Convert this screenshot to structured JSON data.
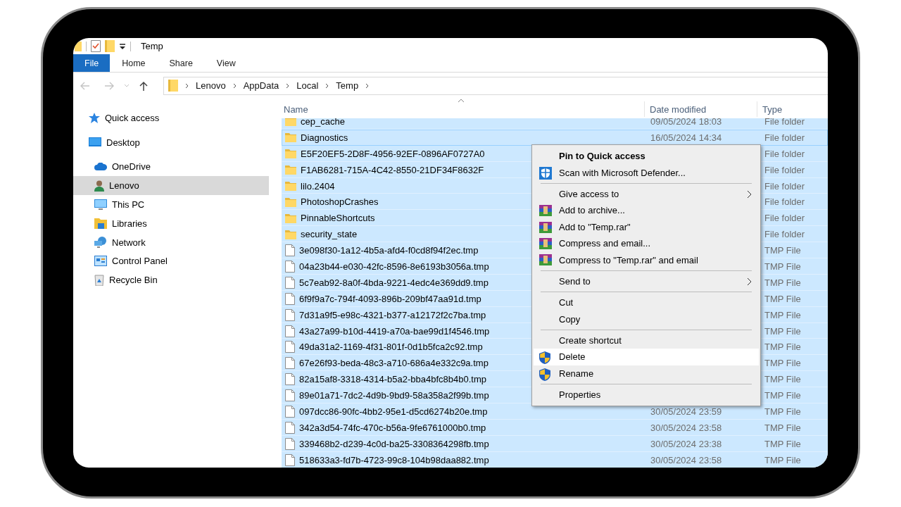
{
  "window": {
    "title": "Temp"
  },
  "ribbon_tabs": [
    {
      "label": "File",
      "selected": true
    },
    {
      "label": "Home",
      "selected": false
    },
    {
      "label": "Share",
      "selected": false
    },
    {
      "label": "View",
      "selected": false
    }
  ],
  "address_bar": {
    "path": [
      "Lenovo",
      "AppData",
      "Local",
      "Temp"
    ]
  },
  "sidebar": {
    "items": [
      {
        "label": "Quick access",
        "kind": "quick-access",
        "selected": false
      },
      {
        "label": "Desktop",
        "kind": "desktop",
        "selected": false,
        "children": [
          {
            "label": "OneDrive",
            "kind": "cloud",
            "selected": false
          },
          {
            "label": "Lenovo",
            "kind": "user",
            "selected": true
          },
          {
            "label": "This PC",
            "kind": "pc",
            "selected": false
          },
          {
            "label": "Libraries",
            "kind": "libraries",
            "selected": false
          },
          {
            "label": "Network",
            "kind": "network",
            "selected": false
          },
          {
            "label": "Control Panel",
            "kind": "control-panel",
            "selected": false
          },
          {
            "label": "Recycle Bin",
            "kind": "recycle-bin",
            "selected": false
          }
        ]
      }
    ]
  },
  "table": {
    "columns": [
      "Name",
      "Date modified",
      "Type"
    ],
    "rows": [
      {
        "name": "cep_cache",
        "kind": "folder",
        "date": "09/05/2024 18:03",
        "type": "File folder",
        "selected": true,
        "focused": false
      },
      {
        "name": "Diagnostics",
        "kind": "folder",
        "date": "16/05/2024 14:34",
        "type": "File folder",
        "selected": true,
        "focused": true
      },
      {
        "name": "E5F20EF5-2D8F-4956-92EF-0896AF0727A0",
        "kind": "folder",
        "type": "File folder",
        "selected": true,
        "focused": false
      },
      {
        "name": "F1AB6281-715A-4C42-8550-21DF34F8632F",
        "kind": "folder",
        "type": "File folder",
        "selected": true,
        "focused": false
      },
      {
        "name": "lilo.2404",
        "kind": "folder",
        "type": "File folder",
        "selected": true,
        "focused": false
      },
      {
        "name": "PhotoshopCrashes",
        "kind": "folder",
        "type": "File folder",
        "selected": true,
        "focused": false
      },
      {
        "name": "PinnableShortcuts",
        "kind": "folder",
        "type": "File folder",
        "selected": true,
        "focused": false
      },
      {
        "name": "security_state",
        "kind": "folder",
        "type": "File folder",
        "selected": true,
        "focused": false
      },
      {
        "name": "3e098f30-1a12-4b5a-afd4-f0cd8f94f2ec.tmp",
        "kind": "file",
        "type": "TMP File",
        "selected": true,
        "focused": false
      },
      {
        "name": "04a23b44-e030-42fc-8596-8e6193b3056a.tmp",
        "kind": "file",
        "type": "TMP File",
        "selected": true,
        "focused": false
      },
      {
        "name": "5c7eab92-8a0f-4bda-9221-4edc4e369dd9.tmp",
        "kind": "file",
        "type": "TMP File",
        "selected": true,
        "focused": false
      },
      {
        "name": "6f9f9a7c-794f-4093-896b-209bf47aa91d.tmp",
        "kind": "file",
        "type": "TMP File",
        "selected": true,
        "focused": false
      },
      {
        "name": "7d31a9f5-e98c-4321-b377-a12172f2c7ba.tmp",
        "kind": "file",
        "type": "TMP File",
        "selected": true,
        "focused": false
      },
      {
        "name": "43a27a99-b10d-4419-a70a-bae99d1f4546.tmp",
        "kind": "file",
        "type": "TMP File",
        "selected": true,
        "focused": false
      },
      {
        "name": "49da31a2-1169-4f31-801f-0d1b5fca2c92.tmp",
        "kind": "file",
        "type": "TMP File",
        "selected": true,
        "focused": false
      },
      {
        "name": "67e26f93-beda-48c3-a710-686a4e332c9a.tmp",
        "kind": "file",
        "type": "TMP File",
        "selected": true,
        "focused": false
      },
      {
        "name": "82a15af8-3318-4314-b5a2-bba4bfc8b4b0.tmp",
        "kind": "file",
        "type": "TMP File",
        "selected": true,
        "focused": false
      },
      {
        "name": "89e01a71-7dc2-4d9b-9bd9-58a358a2f99b.tmp",
        "kind": "file",
        "type": "TMP File",
        "selected": true,
        "focused": false
      },
      {
        "name": "097dcc86-90fc-4bb2-95e1-d5cd6274b20e.tmp",
        "kind": "file",
        "date": "30/05/2024 23:59",
        "type": "TMP File",
        "selected": true,
        "focused": false
      },
      {
        "name": "342a3d54-74fc-470c-b56a-9fe6761000b0.tmp",
        "kind": "file",
        "date": "30/05/2024 23:58",
        "type": "TMP File",
        "selected": true,
        "focused": false
      },
      {
        "name": "339468b2-d239-4c0d-ba25-3308364298fb.tmp",
        "kind": "file",
        "date": "30/05/2024 23:38",
        "type": "TMP File",
        "selected": true,
        "focused": false
      },
      {
        "name": "518633a3-fd7b-4723-99c8-104b98daa882.tmp",
        "kind": "file",
        "date": "30/05/2024 23:58",
        "type": "TMP File",
        "selected": true,
        "focused": false
      }
    ]
  },
  "context_menu": {
    "items": [
      {
        "kind": "plain",
        "label": "Pin to Quick access",
        "default": true,
        "submenu": false,
        "selected": false
      },
      {
        "kind": "defender",
        "label": "Scan with Microsoft Defender...",
        "default": false,
        "submenu": false,
        "selected": false
      },
      {
        "kind": "separator"
      },
      {
        "kind": "plain",
        "label": "Give access to",
        "default": false,
        "submenu": true,
        "selected": false
      },
      {
        "kind": "archive",
        "label": "Add to archive...",
        "default": false,
        "submenu": false,
        "selected": false
      },
      {
        "kind": "archive",
        "label": "Add to \"Temp.rar\"",
        "default": false,
        "submenu": false,
        "selected": false
      },
      {
        "kind": "archive",
        "label": "Compress and email...",
        "default": false,
        "submenu": false,
        "selected": false
      },
      {
        "kind": "archive",
        "label": "Compress to \"Temp.rar\" and email",
        "default": false,
        "submenu": false,
        "selected": false
      },
      {
        "kind": "separator"
      },
      {
        "kind": "plain",
        "label": "Send to",
        "default": false,
        "submenu": true,
        "selected": false
      },
      {
        "kind": "separator"
      },
      {
        "kind": "plain",
        "label": "Cut",
        "default": false,
        "submenu": false,
        "selected": false
      },
      {
        "kind": "plain",
        "label": "Copy",
        "default": false,
        "submenu": false,
        "selected": false
      },
      {
        "kind": "separator"
      },
      {
        "kind": "plain",
        "label": "Create shortcut",
        "default": false,
        "submenu": false,
        "selected": false
      },
      {
        "kind": "elevated",
        "label": "Delete",
        "default": false,
        "submenu": false,
        "selected": true
      },
      {
        "kind": "elevated",
        "label": "Rename",
        "default": false,
        "submenu": false,
        "selected": false
      },
      {
        "kind": "separator"
      },
      {
        "kind": "plain",
        "label": "Properties",
        "default": false,
        "submenu": false,
        "selected": false
      }
    ]
  }
}
